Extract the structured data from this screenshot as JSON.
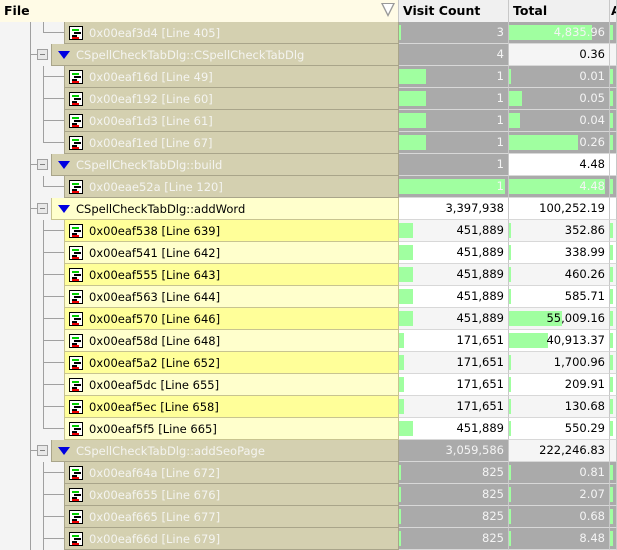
{
  "header": {
    "file": "File",
    "visit_count": "Visit Count",
    "total": "Total",
    "extra": "A"
  },
  "colors": {
    "gray_file": "#d4d0b0",
    "gray_num": "#aaaaaa",
    "yellow_a": "#ffff99",
    "yellow_b": "#ffffcc",
    "bar": "#a0ffa0"
  },
  "rows": [
    {
      "type": "leaf",
      "style": "gray",
      "label": "0x00eaf3d4 [Line 405]",
      "visit": "3",
      "total": "4,835.96",
      "visit_bar": 0.01,
      "total_bar": 0.86,
      "last": true
    },
    {
      "type": "func",
      "style": "gray",
      "label": "CSpellCheckTabDlg::CSpellCheckTabDlg",
      "visit": "4",
      "total": "0.36"
    },
    {
      "type": "leaf",
      "style": "gray",
      "label": "0x00eaf16d [Line 49]",
      "visit": "1",
      "total": "0.01",
      "visit_bar": 0.25,
      "total_bar": 0.02
    },
    {
      "type": "leaf",
      "style": "gray",
      "label": "0x00eaf192 [Line 60]",
      "visit": "1",
      "total": "0.05",
      "visit_bar": 0.25,
      "total_bar": 0.14
    },
    {
      "type": "leaf",
      "style": "gray",
      "label": "0x00eaf1d3 [Line 61]",
      "visit": "1",
      "total": "0.04",
      "visit_bar": 0.25,
      "total_bar": 0.11
    },
    {
      "type": "leaf",
      "style": "gray",
      "label": "0x00eaf1ed [Line 67]",
      "visit": "1",
      "total": "0.26",
      "visit_bar": 0.25,
      "total_bar": 0.72,
      "last": true
    },
    {
      "type": "func",
      "style": "gray",
      "label": "CSpellCheckTabDlg::build",
      "visit": "1",
      "total": "4.48"
    },
    {
      "type": "leaf",
      "style": "gray",
      "label": "0x00eae52a [Line 120]",
      "visit": "1",
      "total": "4.48",
      "visit_bar": 1,
      "total_bar": 1,
      "last": true
    },
    {
      "type": "func",
      "style": "yellow",
      "label": "CSpellCheckTabDlg::addWord",
      "visit": "3,397,938",
      "total": "100,252.19"
    },
    {
      "type": "leaf",
      "style": "yellow",
      "label": "0x00eaf538 [Line 639]",
      "visit": "451,889",
      "total": "352.86",
      "visit_bar": 0.133,
      "total_bar": 0.0035
    },
    {
      "type": "leaf",
      "style": "yellow",
      "label": "0x00eaf541 [Line 642]",
      "visit": "451,889",
      "total": "338.99",
      "visit_bar": 0.133,
      "total_bar": 0.0034
    },
    {
      "type": "leaf",
      "style": "yellow",
      "label": "0x00eaf555 [Line 643]",
      "visit": "451,889",
      "total": "460.26",
      "visit_bar": 0.133,
      "total_bar": 0.0046
    },
    {
      "type": "leaf",
      "style": "yellow",
      "label": "0x00eaf563 [Line 644]",
      "visit": "451,889",
      "total": "585.71",
      "visit_bar": 0.133,
      "total_bar": 0.0058
    },
    {
      "type": "leaf",
      "style": "yellow",
      "label": "0x00eaf570 [Line 646]",
      "visit": "451,889",
      "total": "55,009.16",
      "visit_bar": 0.133,
      "total_bar": 0.549
    },
    {
      "type": "leaf",
      "style": "yellow",
      "label": "0x00eaf58d [Line 648]",
      "visit": "171,651",
      "total": "40,913.37",
      "visit_bar": 0.05,
      "total_bar": 0.408
    },
    {
      "type": "leaf",
      "style": "yellow",
      "label": "0x00eaf5a2 [Line 652]",
      "visit": "171,651",
      "total": "1,700.96",
      "visit_bar": 0.05,
      "total_bar": 0.017
    },
    {
      "type": "leaf",
      "style": "yellow",
      "label": "0x00eaf5dc [Line 655]",
      "visit": "171,651",
      "total": "209.91",
      "visit_bar": 0.05,
      "total_bar": 0.002
    },
    {
      "type": "leaf",
      "style": "yellow",
      "label": "0x00eaf5ec [Line 658]",
      "visit": "171,651",
      "total": "130.68",
      "visit_bar": 0.05,
      "total_bar": 0.0013
    },
    {
      "type": "leaf",
      "style": "yellow",
      "label": "0x00eaf5f5 [Line 665]",
      "visit": "451,889",
      "total": "550.29",
      "visit_bar": 0.133,
      "total_bar": 0.0055,
      "last": true
    },
    {
      "type": "func",
      "style": "gray",
      "label": "CSpellCheckTabDlg::addSeoPage",
      "visit": "3,059,586",
      "total": "222,246.83"
    },
    {
      "type": "leaf",
      "style": "gray",
      "label": "0x00eaf64a [Line 672]",
      "visit": "825",
      "total": "0.81",
      "visit_bar": 0.0003,
      "total_bar": 1e-05
    },
    {
      "type": "leaf",
      "style": "gray",
      "label": "0x00eaf655 [Line 676]",
      "visit": "825",
      "total": "2.07",
      "visit_bar": 0.0003,
      "total_bar": 1e-05
    },
    {
      "type": "leaf",
      "style": "gray",
      "label": "0x00eaf665 [Line 677]",
      "visit": "825",
      "total": "0.68",
      "visit_bar": 0.0003,
      "total_bar": 1e-05
    },
    {
      "type": "leaf",
      "style": "gray",
      "label": "0x00eaf66d [Line 679]",
      "visit": "825",
      "total": "8.48",
      "visit_bar": 0.0003,
      "total_bar": 1e-05
    }
  ]
}
